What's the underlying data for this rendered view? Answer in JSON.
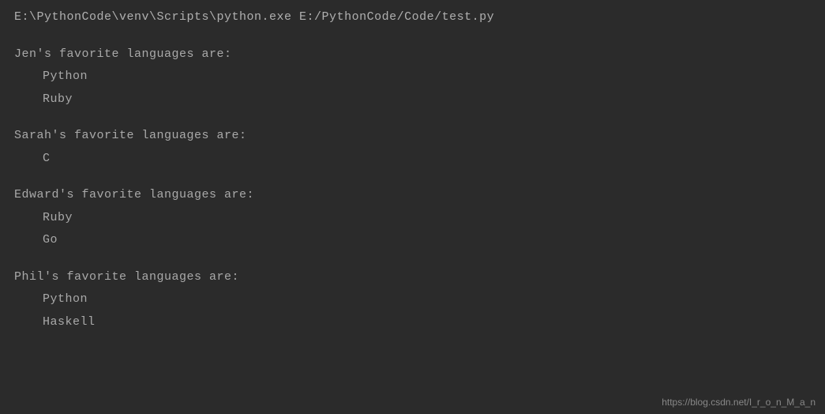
{
  "command": "E:\\PythonCode\\venv\\Scripts\\python.exe E:/PythonCode/Code/test.py",
  "blocks": [
    {
      "header": "Jen's favorite languages are:",
      "items": [
        "Python",
        "Ruby"
      ]
    },
    {
      "header": "Sarah's favorite languages are:",
      "items": [
        "C"
      ]
    },
    {
      "header": "Edward's favorite languages are:",
      "items": [
        "Ruby",
        "Go"
      ]
    },
    {
      "header": "Phil's favorite languages are:",
      "items": [
        "Python",
        "Haskell"
      ]
    }
  ],
  "watermark": "https://blog.csdn.net/I_r_o_n_M_a_n"
}
